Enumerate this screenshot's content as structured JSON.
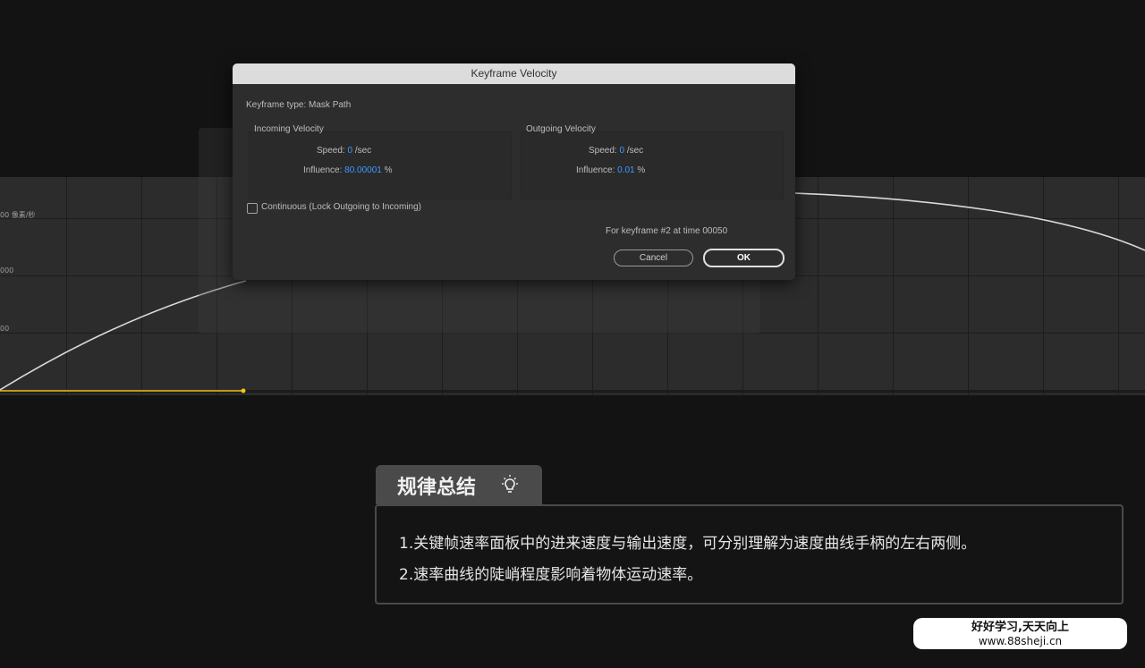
{
  "graph": {
    "y_labels": [
      "00 像素/秒",
      "000",
      "00"
    ],
    "curve_color": "#d9d9d9",
    "baseline_color": "#f2c318"
  },
  "dialog": {
    "title": "Keyframe Velocity",
    "keyframe_type": "Keyframe type: Mask Path",
    "incoming": {
      "title": "Incoming Velocity",
      "speed_label": "Speed:",
      "speed_value": "0",
      "speed_unit": "/sec",
      "influence_label": "Influence:",
      "influence_value": "80.00001",
      "influence_unit": "%"
    },
    "outgoing": {
      "title": "Outgoing Velocity",
      "speed_label": "Speed:",
      "speed_value": "0",
      "speed_unit": "/sec",
      "influence_label": "Influence:",
      "influence_value": "0.01",
      "influence_unit": "%"
    },
    "continuous_label": "Continuous (Lock Outgoing to Incoming)",
    "continuous_checked": false,
    "keyframe_info": "For keyframe #2 at time 00050",
    "cancel_label": "Cancel",
    "ok_label": "OK",
    "accent": "#3a9bff"
  },
  "summary": {
    "title": "规律总结",
    "icon": "lightbulb-icon",
    "lines": [
      "1.关键帧速率面板中的进来速度与输出速度，可分别理解为速度曲线手柄的左右两侧。",
      "2.速率曲线的陡峭程度影响着物体运动速率。"
    ]
  },
  "watermark": {
    "line1": "好好学习,天天向上",
    "line2": "www.88sheji.cn"
  }
}
